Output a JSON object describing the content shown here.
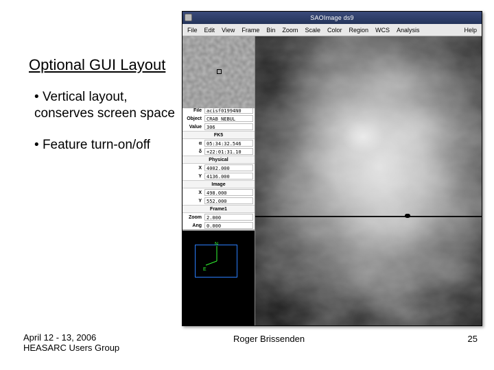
{
  "slide": {
    "heading": "Optional GUI Layout",
    "bullets": [
      "Vertical layout, conserves screen space",
      "Feature turn-on/off"
    ],
    "footer_date": "April 12 - 13, 2006",
    "footer_group": "HEASARC Users Group",
    "footer_center": "Roger Brissenden",
    "page_number": "25"
  },
  "ds9": {
    "title": "SAOImage ds9",
    "menus": [
      "File",
      "Edit",
      "View",
      "Frame",
      "Bin",
      "Zoom",
      "Scale",
      "Color",
      "Region",
      "WCS",
      "Analysis",
      "Help"
    ],
    "info": {
      "File": "acisf01994N0",
      "Object": "CRAB NEBUL",
      "Value": "306",
      "wcs_label": "FK5",
      "alpha": "05:34:32.546",
      "delta": "+22:01:31.10",
      "physical_label": "Physical",
      "phys_x": "4002.000",
      "phys_y": "4136.000",
      "image_label": "Image",
      "img_x": "498.000",
      "img_y": "552.000",
      "frame_label": "Frame1",
      "zoom": "2.000",
      "ang": "0.000"
    }
  }
}
